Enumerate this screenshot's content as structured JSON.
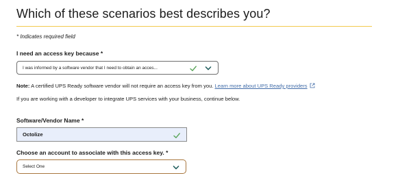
{
  "heading": "Which of these scenarios best describes you?",
  "required_note": "* Indicates required field",
  "reason": {
    "label": "I need an access key because *",
    "selected": "I was informed by a software vendor that I need to obtain an acces..."
  },
  "note": {
    "prefix": "Note:",
    "text": " A certified UPS Ready software vendor will not require an access key from you. ",
    "link": "Learn more about UPS Ready providers"
  },
  "continue_text": "If you are working with a developer to integrate UPS services with your business, continue below.",
  "vendor": {
    "label": "Software/Vendor Name *",
    "value": "Octolize"
  },
  "account": {
    "label": "Choose an account to associate with this access key. *",
    "selected": "Select One"
  },
  "colors": {
    "accent_rule": "#f2c94c",
    "valid_check": "#5aa55a",
    "link": "#426da9",
    "focus_border": "#a8763e",
    "autofill_bg": "#e8eefb"
  }
}
